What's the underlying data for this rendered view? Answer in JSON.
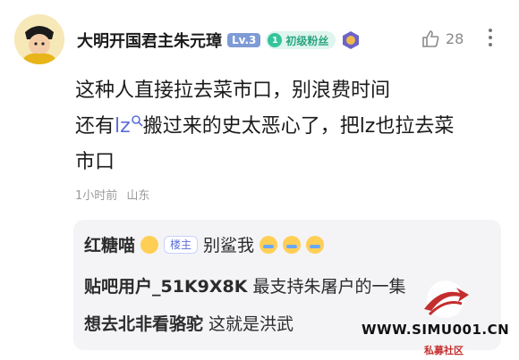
{
  "post": {
    "username": "大明开国君主朱元璋",
    "level": "Lv.3",
    "fan_badge": "初级粉丝",
    "like_count": "28",
    "content_line1": "这种人直接拉去菜市口，别浪费时间",
    "content_line2_prefix": "还有",
    "content_line2_lz": "lz",
    "content_line2_suffix": "搬过来的史太恶心了，把lz也拉去菜",
    "content_line3": "市口",
    "time": "1小时前",
    "location": "山东"
  },
  "replies": [
    {
      "name": "红糖喵",
      "badge": "楼主",
      "text": "别鲨我"
    },
    {
      "name": "贴吧用户_51K9X8K",
      "text": "最支持朱屠户的一集"
    },
    {
      "name": "想去北非看骆驼",
      "text": "这就是洪武"
    }
  ],
  "watermark": {
    "text": "WWW.SIMU001.CN",
    "sub": "私募社区"
  },
  "icons": [
    "avatar-emperor",
    "level-badge",
    "fan-diamond-icon",
    "medal-icon",
    "thumb-up-icon",
    "more-icon",
    "search-lz-icon"
  ],
  "colors": {
    "accent": "#5b6fd8",
    "fan": "#2ca681",
    "reply_bg": "#f4f4f7"
  }
}
